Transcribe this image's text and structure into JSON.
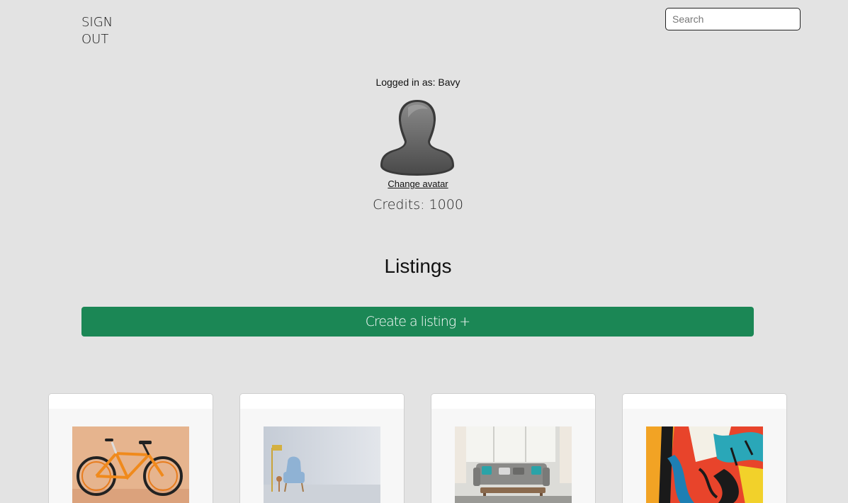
{
  "header": {
    "sign_out": "SIGN OUT",
    "search_placeholder": "Search"
  },
  "profile": {
    "logged_in_text": "Logged in as: Bavy",
    "change_avatar": "Change avatar",
    "credits_text": "Credits: 1000"
  },
  "listings": {
    "title": "Listings",
    "create_button": "Create a listing +",
    "cards": [
      {
        "image": "bicycle-photo"
      },
      {
        "image": "armchair-photo"
      },
      {
        "image": "living-room-photo"
      },
      {
        "image": "abstract-painting-photo"
      }
    ]
  },
  "colors": {
    "background": "#e3e3e3",
    "accent": "#1b8755"
  }
}
